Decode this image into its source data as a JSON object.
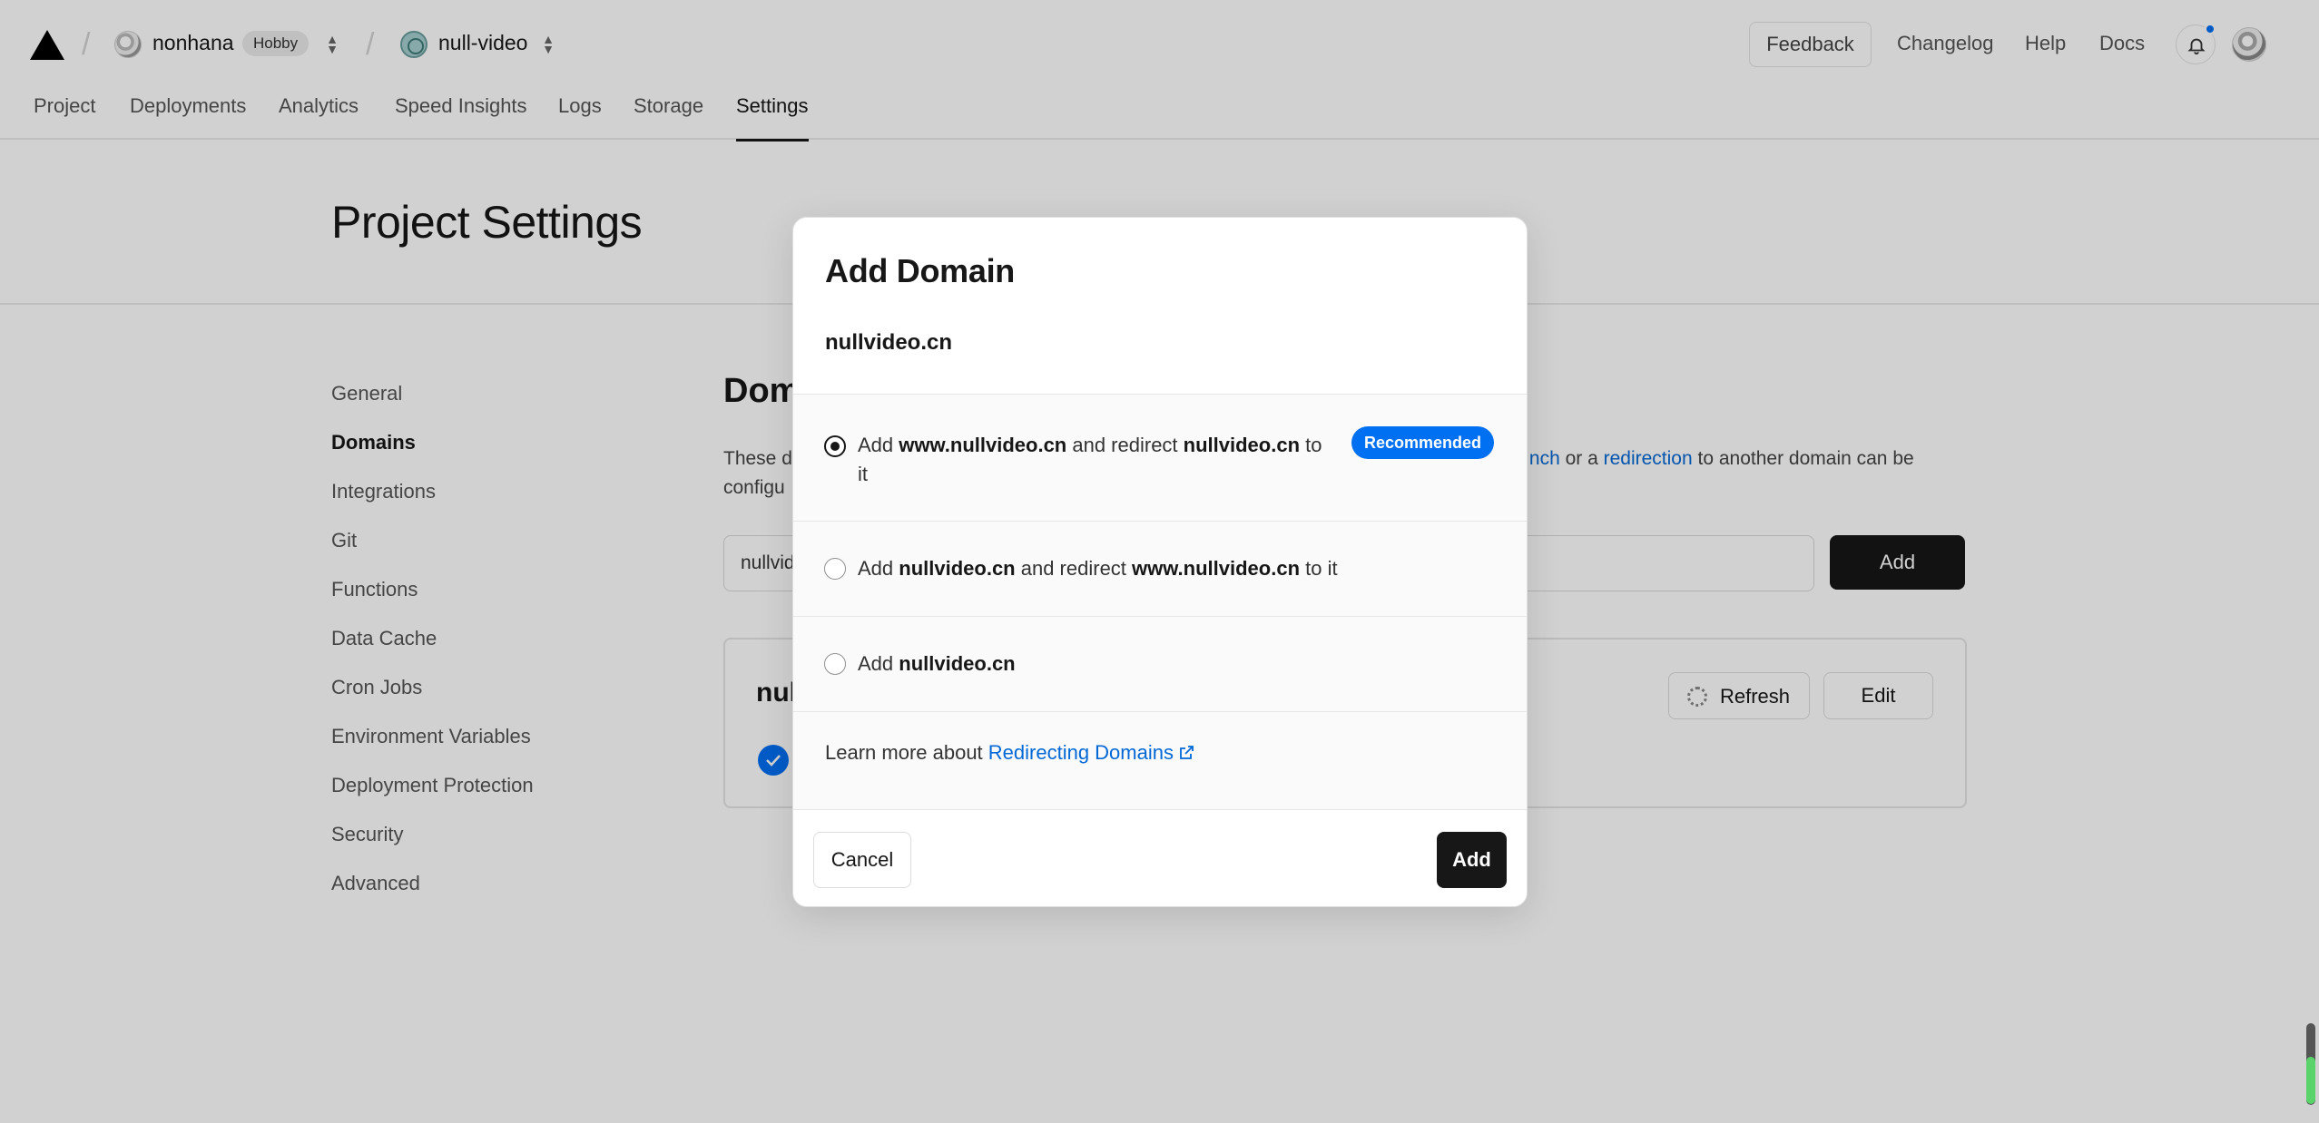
{
  "header": {
    "team": {
      "name": "nonhana",
      "plan_badge": "Hobby"
    },
    "project": {
      "name": "null-video"
    },
    "right": {
      "feedback": "Feedback",
      "changelog": "Changelog",
      "help": "Help",
      "docs": "Docs"
    }
  },
  "tabs": [
    "Project",
    "Deployments",
    "Analytics",
    "Speed Insights",
    "Logs",
    "Storage",
    "Settings"
  ],
  "active_tab": "Settings",
  "page": {
    "title": "Project Settings",
    "sidebar": [
      "General",
      "Domains",
      "Integrations",
      "Git",
      "Functions",
      "Data Cache",
      "Cron Jobs",
      "Environment Variables",
      "Deployment Protection",
      "Security",
      "Advanced"
    ],
    "active_sidebar": "Domains",
    "section": {
      "title_visible": "Dom",
      "desc_line1_left": "These d",
      "desc_link1": "nch",
      "desc_mid": " or a ",
      "desc_link2": "redirection",
      "desc_after": " to another domain can be",
      "desc_line2_left": "configu",
      "input_value": "nullvid",
      "add_button": "Add",
      "card": {
        "name_visible": "nul",
        "refresh": "Refresh",
        "edit": "Edit"
      }
    }
  },
  "modal": {
    "title": "Add Domain",
    "domain": "nullvideo.cn",
    "options": [
      {
        "p1": "Add ",
        "b1": "www.nullvideo.cn",
        "p2": " and redirect ",
        "b2": "nullvideo.cn",
        "p3": " to it",
        "badge": "Recommended",
        "checked": true
      },
      {
        "p1": "Add ",
        "b1": "nullvideo.cn",
        "p2": " and redirect ",
        "b2": "www.nullvideo.cn",
        "p3": " to it",
        "checked": false
      },
      {
        "p1": "Add ",
        "b1": "nullvideo.cn",
        "checked": false
      }
    ],
    "learn_more_prefix": "Learn more about ",
    "learn_more_link": "Redirecting Domains",
    "cancel": "Cancel",
    "add": "Add"
  },
  "colors": {
    "accent_blue": "#0070f3",
    "link_blue": "#0068d6",
    "primary_button": "#171717"
  }
}
